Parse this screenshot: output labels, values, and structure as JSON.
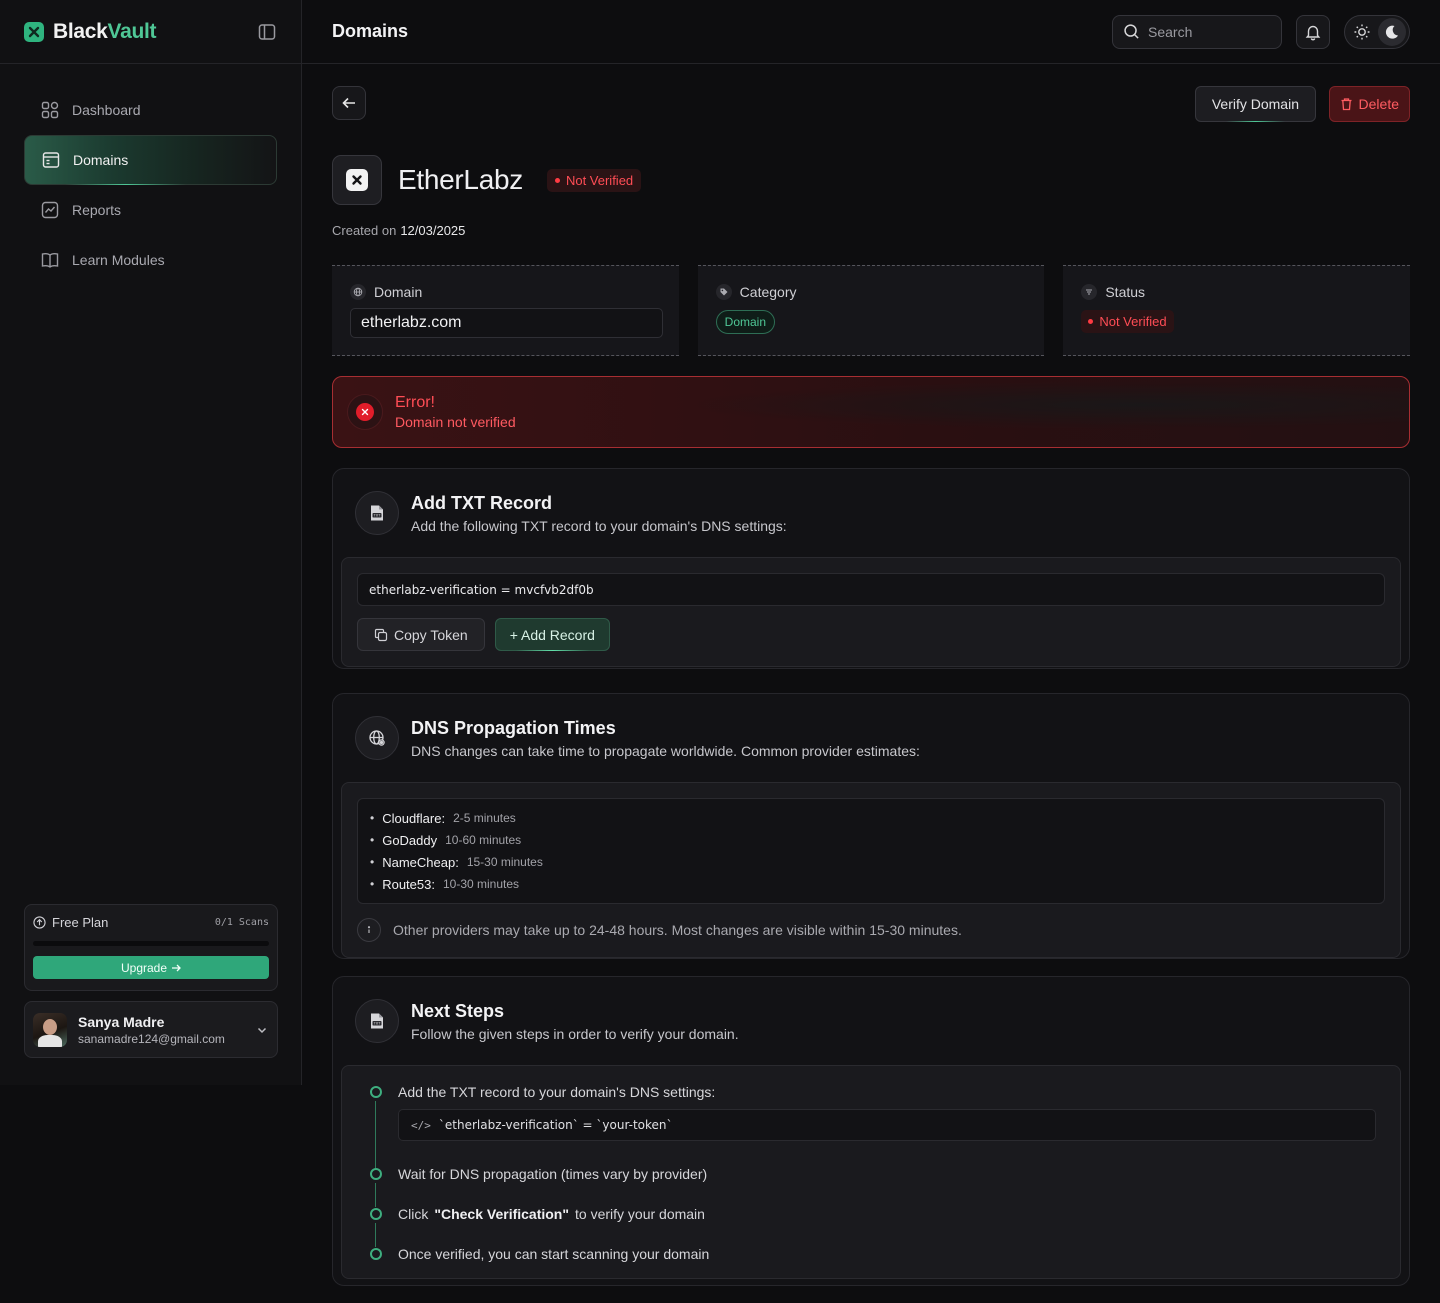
{
  "app": {
    "brand_left": "Black",
    "brand_right": "Vault"
  },
  "sidebar": {
    "items": [
      {
        "label": "Dashboard",
        "icon": "grid-icon"
      },
      {
        "label": "Domains",
        "icon": "browser-icon",
        "active": true
      },
      {
        "label": "Reports",
        "icon": "chart-icon"
      },
      {
        "label": "Learn Modules",
        "icon": "book-icon"
      }
    ],
    "plan": {
      "label": "Free Plan",
      "count": "0/1 Scans",
      "progress": 0,
      "upgrade_label": "Upgrade"
    },
    "user": {
      "name": "Sanya Madre",
      "email": "sanamadre124@gmail.com"
    }
  },
  "header": {
    "title": "Domains",
    "search_placeholder": "Search"
  },
  "actions": {
    "verify": "Verify Domain",
    "delete": "Delete"
  },
  "domain": {
    "name": "EtherLabz",
    "status_badge": "Not Verified",
    "created_label": "Created on",
    "created_date": "12/03/2025"
  },
  "info": {
    "domain_label": "Domain",
    "domain_value": "etherlabz.com",
    "category_label": "Category",
    "category_value": "Domain",
    "status_label": "Status",
    "status_value": "Not Verified"
  },
  "error": {
    "title": "Error!",
    "message": "Domain not verified"
  },
  "txt_section": {
    "title": "Add TXT Record",
    "subtitle": "Add the following TXT record to your domain's DNS settings:",
    "token": "etherlabz-verification = mvcfvb2df0b",
    "copy_label": "Copy Token",
    "add_label": "+ Add Record"
  },
  "dns_section": {
    "title": "DNS Propagation Times",
    "subtitle": "DNS changes can take time to propagate worldwide. Common provider estimates:",
    "providers": [
      {
        "name": "Cloudflare:",
        "time": "2-5 minutes"
      },
      {
        "name": "GoDaddy",
        "time": "10-60 minutes"
      },
      {
        "name": "NameCheap:",
        "time": "15-30 minutes"
      },
      {
        "name": "Route53:",
        "time": "10-30 minutes"
      }
    ],
    "note": "Other providers may take up to 24-48 hours. Most changes are visible within 15-30 minutes."
  },
  "steps_section": {
    "title": "Next Steps",
    "subtitle": "Follow the given steps in order to verify your domain.",
    "step1": "Add the TXT record to your domain's DNS settings:",
    "step1_code_tag": "</>",
    "step1_code": "`etherlabz-verification` = `your-token`",
    "step2": "Wait for DNS propagation (times vary by provider)",
    "step3_pre": "Click",
    "step3_bold": "\"Check Verification\"",
    "step3_post": "to verify your domain",
    "step4": "Once verified, you can start scanning your domain"
  },
  "colors": {
    "accent": "#2fb47f",
    "danger": "#ff4d55",
    "background": "#0d0d0f"
  }
}
